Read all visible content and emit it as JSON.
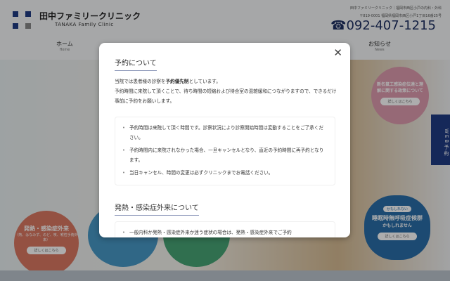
{
  "header": {
    "clinic_name": "田中ファミリークリニック",
    "clinic_name_en": "TANAKA Family Clinic",
    "tagline": "田中ファミリークリニック｜福岡市西区小戸の内科・外科",
    "address": "〒819-0001 福岡県福岡市西区小戸1丁目16番25号",
    "phone": "092-407-1215"
  },
  "nav": [
    {
      "label": "ホーム",
      "sub": "Home"
    },
    {
      "label": "お知らせ",
      "sub": "News"
    }
  ],
  "banners": {
    "fever": "発熱・感染症外来",
    "fever_sub": "（熱、はなみず、のど、咳、喉性手術外来）",
    "more": "詳しくはこちら",
    "pink": "新名鼠工感染症伝達と理解に関する政策について",
    "sleep_badge": "かもしれない",
    "sleep": "睡眠時無呼吸症候群",
    "sleep_sub": "かもしれません",
    "web_reservation": "WEB予約"
  },
  "modal": {
    "title1": "予約について",
    "intro_pre": "当院では患者様の診察を",
    "intro_bold": "予約優先制",
    "intro_post": "としています。",
    "intro2": "予約時間に来院して頂くことで、待ち時間の短縮および待合室の混雑緩和につながりますので、できるだけ事前に予約をお願いします。",
    "notes": [
      "予約時間は来院して頂く時間です。診察状況により診察開始時間は変動することをご了承ください。",
      "予約時間内に来院されなかった場合、一旦キャンセルとなり、直近の予約時間に再予約となります。",
      "当日キャンセル、時間の変更は必ずクリニックまでお電話ください。"
    ],
    "title2": "発熱・感染症外来について",
    "notes2": [
      "一般内科か発熱・感染症外来か迷う症状の場合は、発熱・感染症外来でご予約"
    ]
  }
}
